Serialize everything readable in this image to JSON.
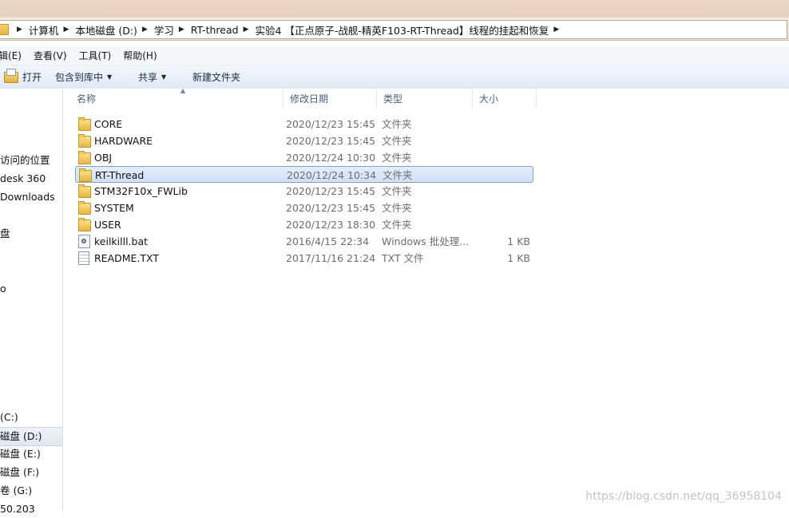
{
  "breadcrumbs": [
    "计算机",
    "本地磁盘 (D:)",
    "学习",
    "RT-thread",
    "实验4 【正点原子-战舰-精英F103-RT-Thread】线程的挂起和恢复"
  ],
  "menu": [
    "辑(E)",
    "查看(V)",
    "工具(T)",
    "帮助(H)"
  ],
  "commands": {
    "open": "打开",
    "include_in_library": "包含到库中",
    "share": "共享",
    "new_folder": "新建文件夹"
  },
  "nav": [
    "访问的位置",
    "desk 360",
    "Downloads",
    "盘",
    "o",
    "(C:)",
    "磁盘 (D:)",
    "磁盘 (E:)",
    "磁盘 (F:)",
    "卷 (G:)",
    "50.203"
  ],
  "columns": {
    "name": "名称",
    "date": "修改日期",
    "type": "类型",
    "size": "大小"
  },
  "files": [
    {
      "name": "CORE",
      "date": "2020/12/23 15:45",
      "type": "文件夹",
      "size": "",
      "icon": "folder-icon"
    },
    {
      "name": "HARDWARE",
      "date": "2020/12/23 15:45",
      "type": "文件夹",
      "size": "",
      "icon": "folder-icon"
    },
    {
      "name": "OBJ",
      "date": "2020/12/24 10:30",
      "type": "文件夹",
      "size": "",
      "icon": "folder-icon"
    },
    {
      "name": "RT-Thread",
      "date": "2020/12/24 10:34",
      "type": "文件夹",
      "size": "",
      "icon": "folder-icon"
    },
    {
      "name": "STM32F10x_FWLib",
      "date": "2020/12/23 15:45",
      "type": "文件夹",
      "size": "",
      "icon": "folder-icon"
    },
    {
      "name": "SYSTEM",
      "date": "2020/12/23 15:45",
      "type": "文件夹",
      "size": "",
      "icon": "folder-icon"
    },
    {
      "name": "USER",
      "date": "2020/12/23 18:30",
      "type": "文件夹",
      "size": "",
      "icon": "folder-icon"
    },
    {
      "name": "keilkilll.bat",
      "date": "2016/4/15 22:34",
      "type": "Windows 批处理...",
      "size": "1 KB",
      "icon": "bat-file-icon"
    },
    {
      "name": "README.TXT",
      "date": "2017/11/16 21:24",
      "type": "TXT 文件",
      "size": "1 KB",
      "icon": "text-file-icon"
    }
  ],
  "watermark": "https://blog.csdn.net/qq_36958104"
}
